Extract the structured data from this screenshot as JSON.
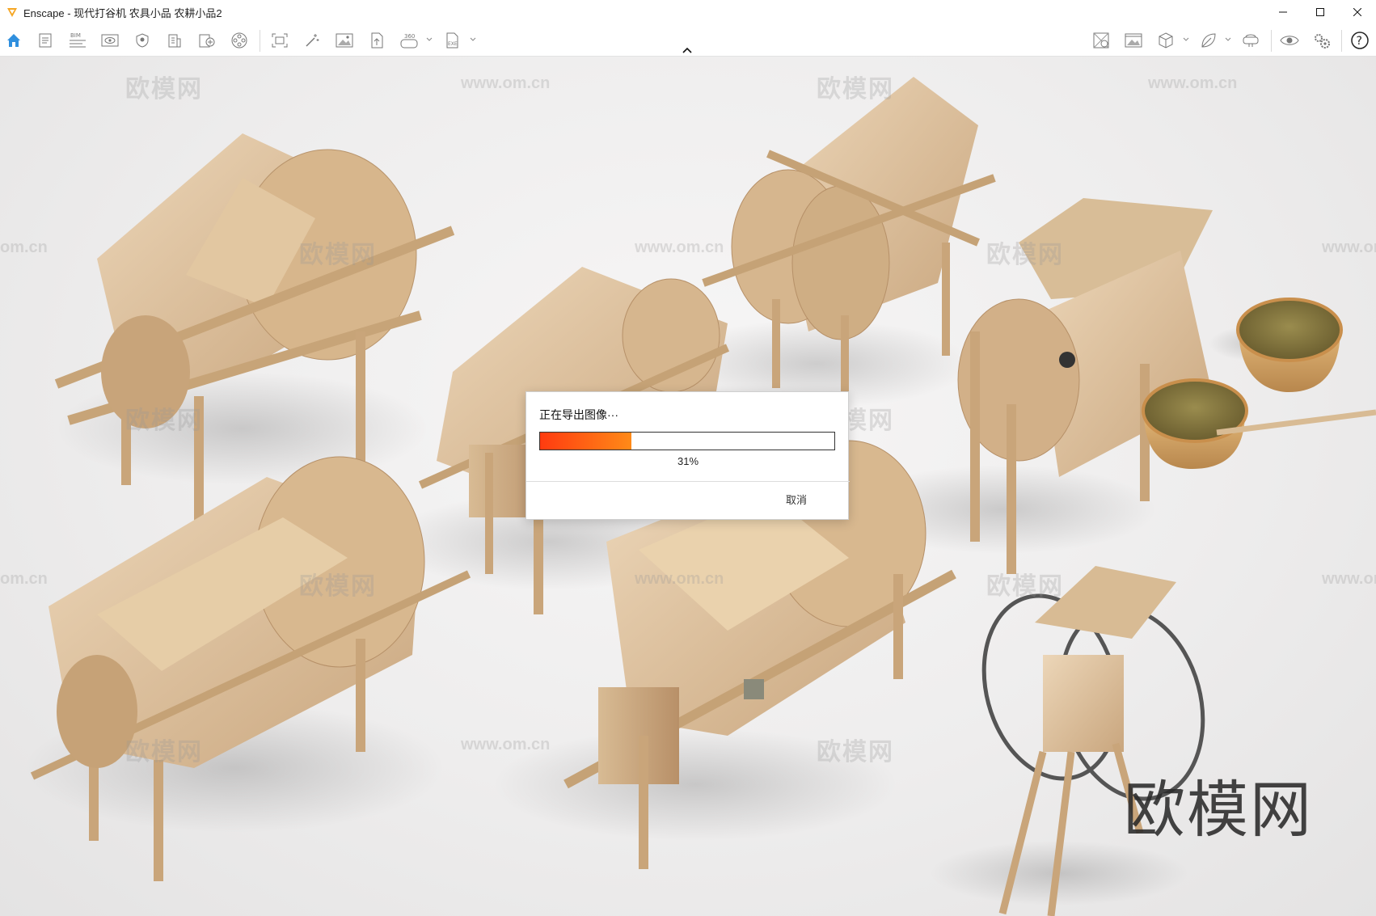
{
  "window": {
    "title": "Enscape - 现代打谷机 农具小品 农耕小品2",
    "accent": "#f5a623"
  },
  "toolbar": {
    "left_icons": [
      "home-icon",
      "document-icon",
      "bim-icon",
      "view-icon",
      "shield-icon",
      "building-icon",
      "asset-library-icon",
      "video-reel-icon",
      "screenshot-icon",
      "magic-wand-icon",
      "image-icon",
      "panorama-upload-icon",
      "panorama-360-icon",
      "export-exe-icon"
    ],
    "bim_label": "BIM",
    "pano_label": "360",
    "exe_label": "EXE",
    "right_icons": [
      "material-editor-icon",
      "batch-render-icon",
      "cube-view-icon",
      "leaf-icon",
      "vr-headset-icon",
      "eye-icon",
      "settings-icon",
      "help-icon"
    ],
    "help_label": "?"
  },
  "watermarks": {
    "logo": "欧模网",
    "url": "www.om.cn",
    "url_edge": "om.cn",
    "big": "欧模网"
  },
  "dialog": {
    "message": "正在导出图像···",
    "progress": 0.31,
    "percent_label": "31%",
    "cancel_label": "取消",
    "progress_colors": [
      "#ff3b10",
      "#ff8a18"
    ]
  }
}
